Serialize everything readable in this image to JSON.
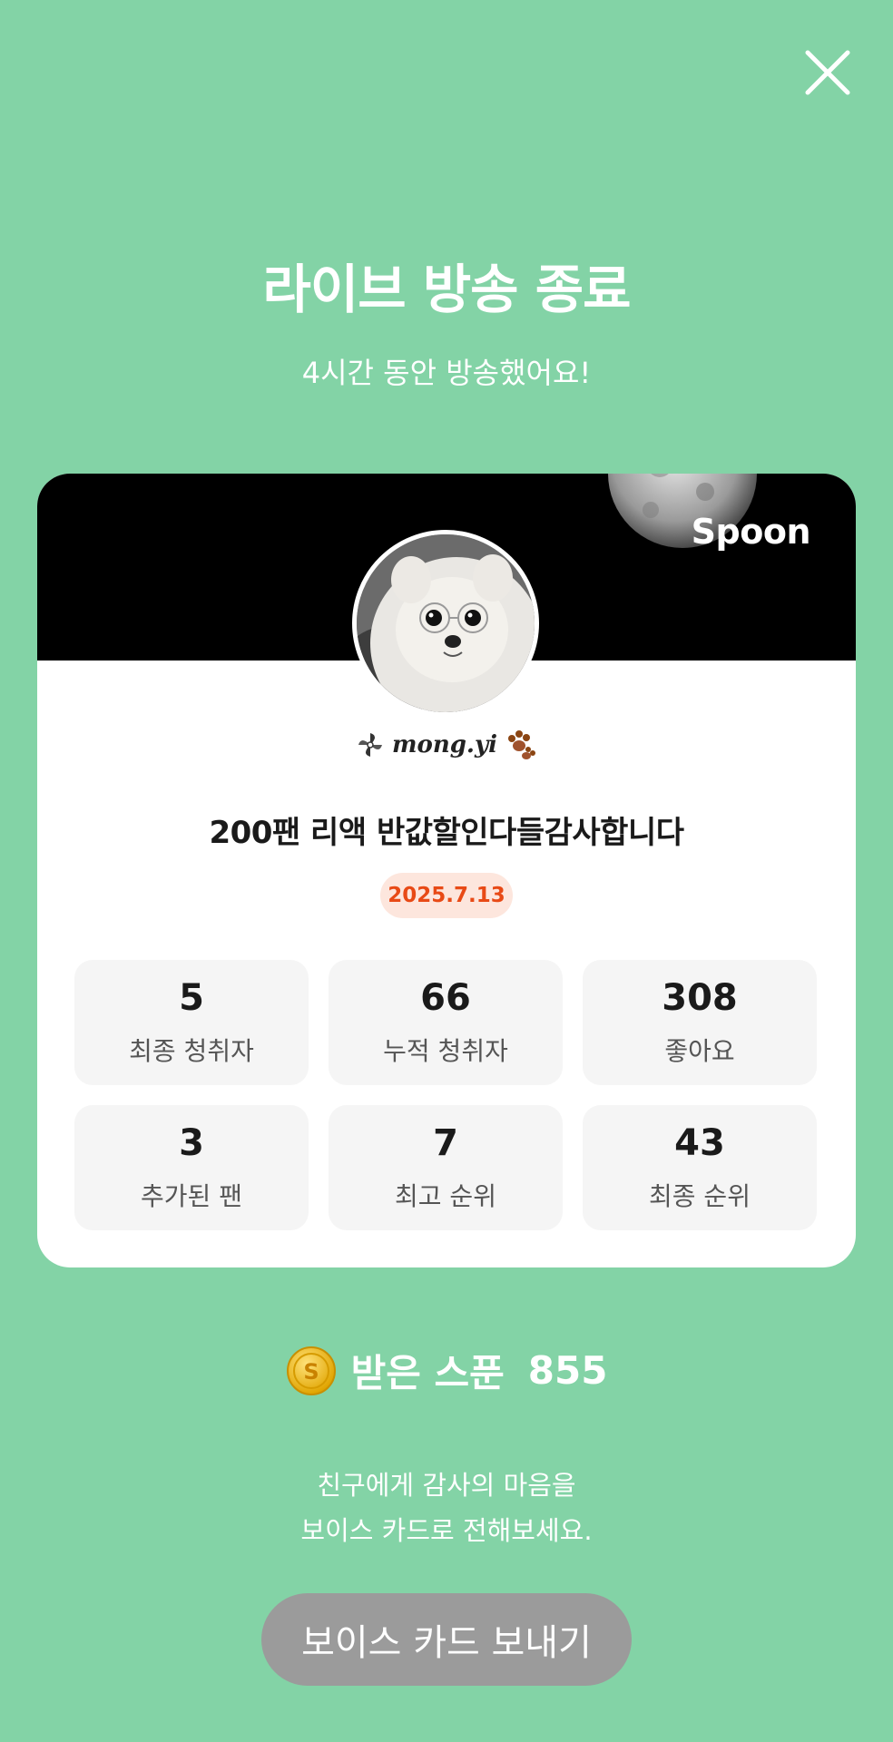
{
  "header": {
    "close_icon": "close-icon",
    "title": "라이브 방송 종료",
    "subtitle": "4시간 동안 방송했어요!"
  },
  "card": {
    "brand": "Spoon",
    "username": "mong.yi",
    "stream_title": "200팬 리액 반값할인다들감사합니다",
    "date": "2025.7.13",
    "stats": [
      {
        "value": "5",
        "label": "최종 청취자"
      },
      {
        "value": "66",
        "label": "누적 청취자"
      },
      {
        "value": "308",
        "label": "좋아요"
      },
      {
        "value": "3",
        "label": "추가된 팬"
      },
      {
        "value": "7",
        "label": "최고 순위"
      },
      {
        "value": "43",
        "label": "최종 순위"
      }
    ]
  },
  "spoons": {
    "label": "받은 스푼",
    "value": "855",
    "icon": "coin-icon"
  },
  "message": {
    "line1": "친구에게 감사의 마음을",
    "line2": "보이스 카드로 전해보세요."
  },
  "cta": {
    "label": "보이스 카드 보내기"
  },
  "colors": {
    "background": "#83d3a6",
    "date_text": "#e84a16",
    "date_bg": "#fde6dd",
    "button_bg": "#9b9b9b"
  }
}
